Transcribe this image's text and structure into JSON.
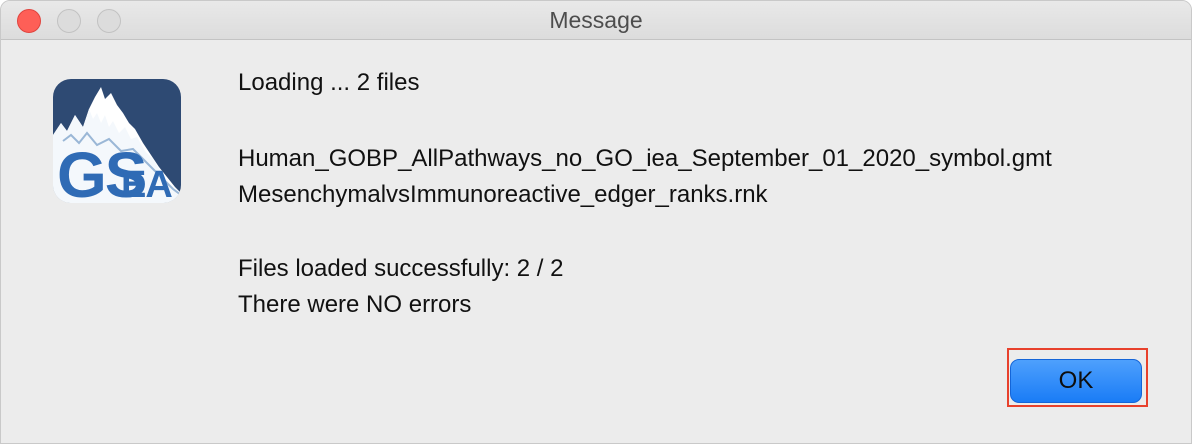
{
  "window": {
    "title": "Message"
  },
  "logo": {
    "alt": "GSEA",
    "icon": "gsea-logo-icon",
    "colors": {
      "background": "#2e4a73",
      "text": "#2f6bb5",
      "peaks": "#ffffff"
    }
  },
  "message": {
    "loading": "Loading ... 2 files",
    "files": [
      "Human_GOBP_AllPathways_no_GO_iea_September_01_2020_symbol.gmt",
      "MesenchymalvsImmunoreactive_edger_ranks.rnk"
    ],
    "success": "Files loaded successfully: 2 / 2",
    "errors": "There were NO errors"
  },
  "buttons": {
    "ok_label": "OK",
    "ok_color": "#1a7cf6",
    "highlight_color": "#e8412c"
  }
}
